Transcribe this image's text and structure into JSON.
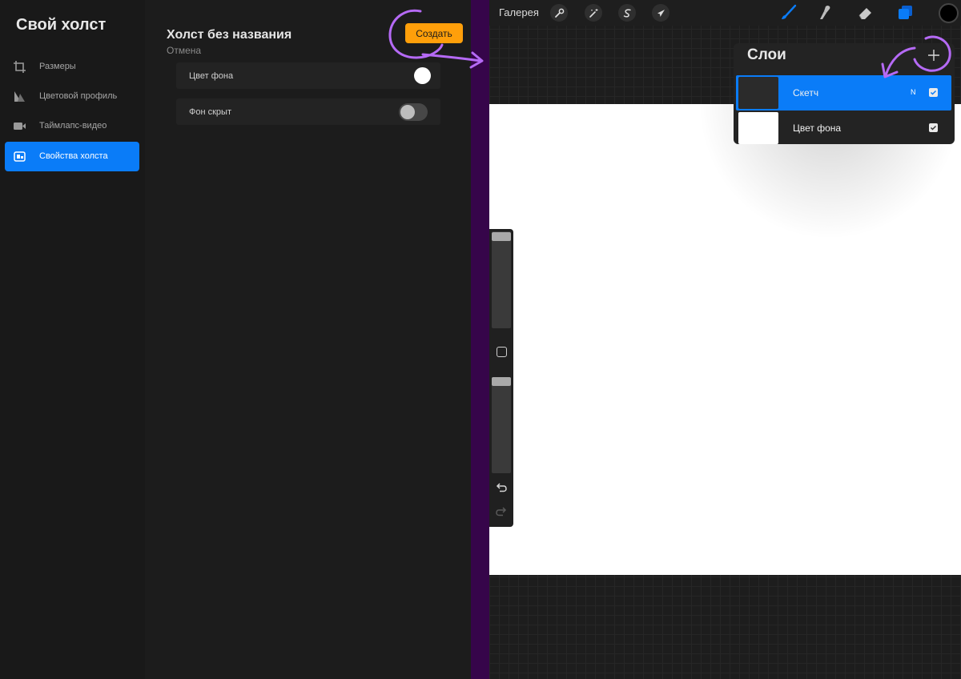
{
  "left_sidebar": {
    "title": "Свой холст",
    "items": [
      {
        "label": "Размеры",
        "icon": "crop-icon"
      },
      {
        "label": "Цветовой профиль",
        "icon": "color-profile-icon"
      },
      {
        "label": "Таймлапс-видео",
        "icon": "video-camera-icon"
      },
      {
        "label": "Свойства холста",
        "icon": "canvas-properties-icon",
        "active": true
      }
    ]
  },
  "canvas_settings": {
    "name": "Холст без названия",
    "cancel_label": "Отмена",
    "create_label": "Создать",
    "rows": [
      {
        "label": "Цвет фона",
        "control": "color-swatch",
        "value": "#ffffff"
      },
      {
        "label": "Фон скрыт",
        "control": "toggle",
        "value": "off"
      }
    ]
  },
  "toolbar": {
    "gallery_label": "Галерея",
    "left_tools": [
      "wrench-icon",
      "magic-wand-icon",
      "selection-s-icon",
      "move-arrow-icon"
    ],
    "right_tools": [
      "brush-icon",
      "smudge-icon",
      "eraser-icon",
      "layers-icon",
      "color-picker-icon"
    ],
    "active_tool": "brush-icon",
    "accent_color": "#0a7cf8",
    "current_color": "#000000"
  },
  "layers_panel": {
    "title": "Слои",
    "layers": [
      {
        "name": "Скетч",
        "mode": "N",
        "visible": true,
        "active": true
      },
      {
        "name": "Цвет фона",
        "mode": "",
        "visible": true,
        "active": false
      }
    ]
  },
  "colors": {
    "create_button": "#ff9f0a",
    "divider": "#36054a",
    "annotation": "#b56af5"
  }
}
